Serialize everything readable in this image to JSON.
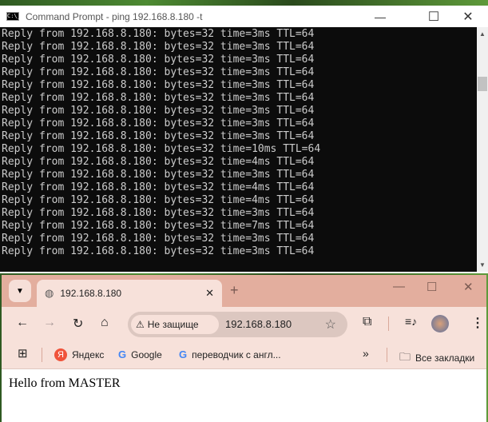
{
  "cmd": {
    "title": "Command Prompt - ping  192.168.8.180 -t",
    "icon": "C:\\_",
    "lines": [
      "Reply from 192.168.8.180: bytes=32 time=3ms TTL=64",
      "Reply from 192.168.8.180: bytes=32 time=3ms TTL=64",
      "Reply from 192.168.8.180: bytes=32 time=3ms TTL=64",
      "Reply from 192.168.8.180: bytes=32 time=3ms TTL=64",
      "Reply from 192.168.8.180: bytes=32 time=3ms TTL=64",
      "Reply from 192.168.8.180: bytes=32 time=3ms TTL=64",
      "Reply from 192.168.8.180: bytes=32 time=3ms TTL=64",
      "Reply from 192.168.8.180: bytes=32 time=3ms TTL=64",
      "Reply from 192.168.8.180: bytes=32 time=3ms TTL=64",
      "Reply from 192.168.8.180: bytes=32 time=10ms TTL=64",
      "Reply from 192.168.8.180: bytes=32 time=4ms TTL=64",
      "Reply from 192.168.8.180: bytes=32 time=3ms TTL=64",
      "Reply from 192.168.8.180: bytes=32 time=4ms TTL=64",
      "Reply from 192.168.8.180: bytes=32 time=4ms TTL=64",
      "Reply from 192.168.8.180: bytes=32 time=3ms TTL=64",
      "Reply from 192.168.8.180: bytes=32 time=7ms TTL=64",
      "Reply from 192.168.8.180: bytes=32 time=3ms TTL=64",
      "Reply from 192.168.8.180: bytes=32 time=3ms TTL=64"
    ]
  },
  "browser": {
    "tab_title": "192.168.8.180",
    "security_chip": "Не защище",
    "url": "192.168.8.180",
    "bookmarks": [
      "Яндекс",
      "Google",
      "переводчик с англ..."
    ],
    "all_bookmarks": "Все закладки",
    "content": "Hello from MASTER"
  }
}
